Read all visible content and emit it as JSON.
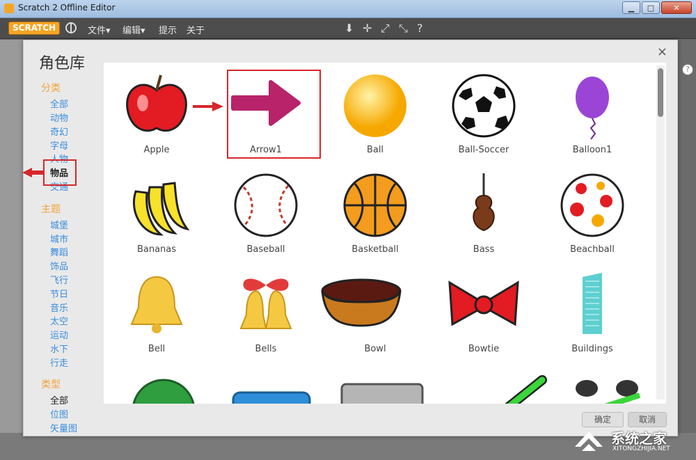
{
  "window": {
    "title": "Scratch 2 Offline Editor",
    "minimize": "▁",
    "maximize": "□",
    "close": "✕"
  },
  "menubar": {
    "logo": "SCRATCH",
    "items": [
      "文件▾",
      "编辑▾",
      "提示",
      "关于"
    ],
    "tools": [
      "⬇",
      "✛",
      "⤢",
      "⤡",
      "?"
    ]
  },
  "dialog": {
    "title": "角色库",
    "close": "×",
    "help": "?"
  },
  "sidebar": {
    "category_heading": "分类",
    "categories": [
      "全部",
      "动物",
      "奇幻",
      "字母",
      "人物",
      "物品",
      "交通"
    ],
    "active_category": "物品",
    "theme_heading": "主题",
    "themes": [
      "城堡",
      "城市",
      "舞蹈",
      "饰品",
      "飞行",
      "节日",
      "音乐",
      "太空",
      "运动",
      "水下",
      "行走"
    ],
    "type_heading": "类型",
    "types": [
      "全部",
      "位图",
      "矢量图"
    ],
    "active_type": "全部"
  },
  "library": {
    "items": [
      {
        "label": "Apple",
        "icon": "apple-icon"
      },
      {
        "label": "Arrow1",
        "icon": "arrow-icon"
      },
      {
        "label": "Ball",
        "icon": "ball-icon"
      },
      {
        "label": "Ball-Soccer",
        "icon": "soccer-ball-icon"
      },
      {
        "label": "Balloon1",
        "icon": "balloon-icon"
      },
      {
        "label": "Bananas",
        "icon": "bananas-icon"
      },
      {
        "label": "Baseball",
        "icon": "baseball-icon"
      },
      {
        "label": "Basketball",
        "icon": "basketball-icon"
      },
      {
        "label": "Bass",
        "icon": "bass-icon"
      },
      {
        "label": "Beachball",
        "icon": "beachball-icon"
      },
      {
        "label": "Bell",
        "icon": "bell-icon"
      },
      {
        "label": "Bells",
        "icon": "bells-icon"
      },
      {
        "label": "Bowl",
        "icon": "bowl-icon"
      },
      {
        "label": "Bowtie",
        "icon": "bowtie-icon"
      },
      {
        "label": "Buildings",
        "icon": "buildings-icon"
      }
    ],
    "selected": "Arrow1"
  },
  "footer": {
    "ok": "确定",
    "cancel": "取消"
  },
  "watermark": {
    "text": "系统之家",
    "url": "XITONGZHIJIA.NET"
  },
  "colors": {
    "accent_orange": "#f2a33a",
    "link_blue": "#3a8dde",
    "annotation_red": "#d7262b"
  }
}
